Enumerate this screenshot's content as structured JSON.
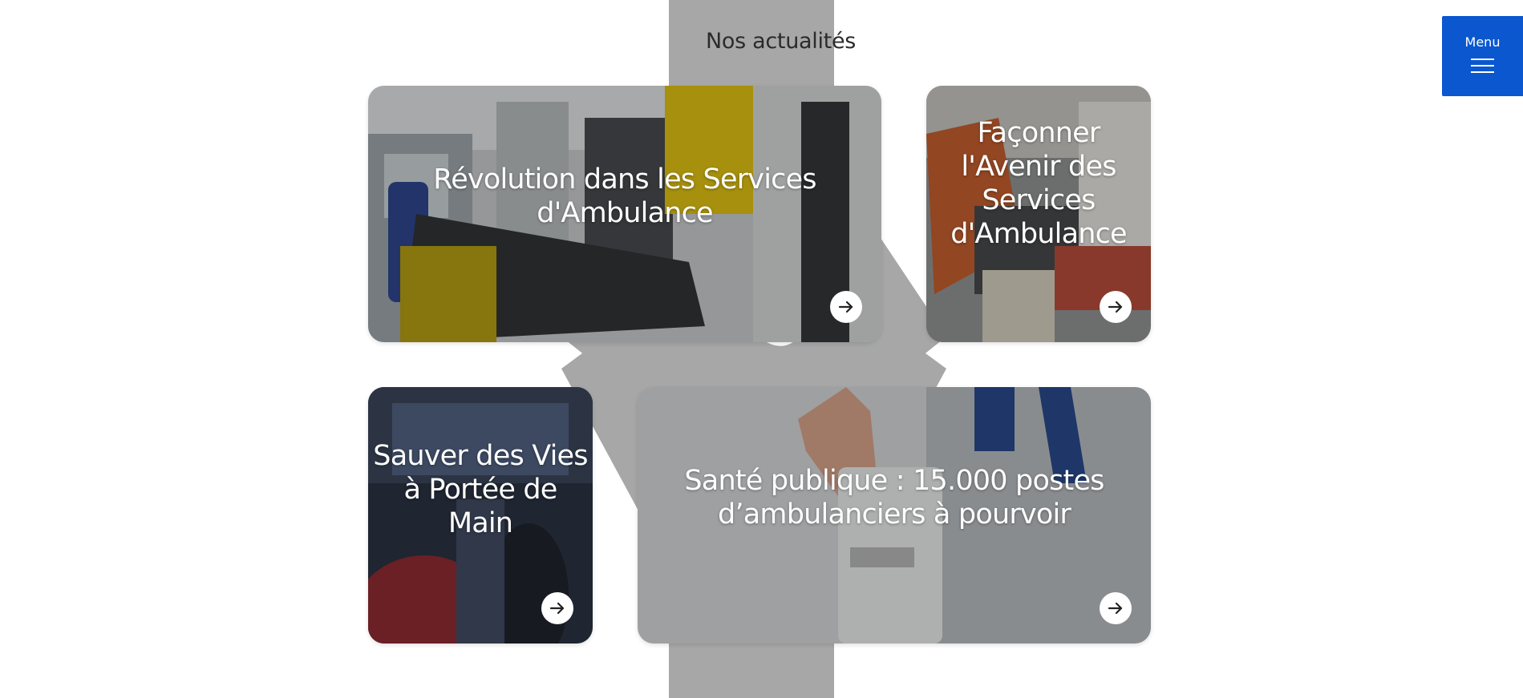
{
  "section": {
    "title": "Nos actualités"
  },
  "menu": {
    "label": "Menu",
    "icon": "hamburger-icon",
    "color": "#0a57d0"
  },
  "cards": [
    {
      "title": "Révolution dans les Services d'Ambulance",
      "icon": "arrow-right-icon"
    },
    {
      "title": "Façonner l'Avenir des Services d'Ambulance",
      "icon": "arrow-right-icon"
    },
    {
      "title": "Sauver des Vies à Portée de Main",
      "icon": "arrow-right-icon"
    },
    {
      "title": "Santé publique : 15.000 postes d’ambulanciers à pourvoir",
      "icon": "arrow-right-icon"
    }
  ],
  "background": {
    "icon": "star-of-life-icon",
    "color": "#a6a6a6"
  }
}
